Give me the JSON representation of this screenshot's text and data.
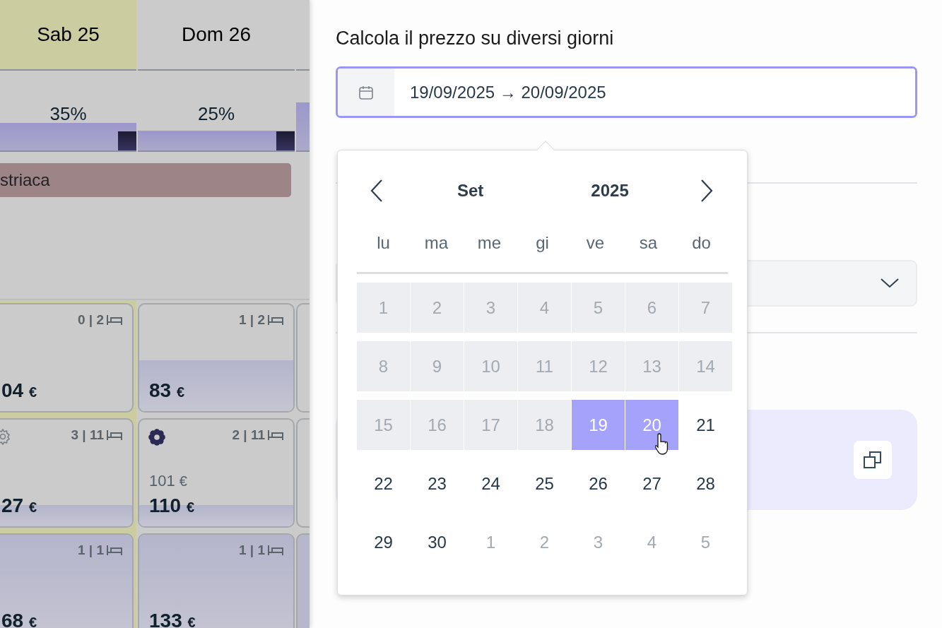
{
  "planner": {
    "columns": [
      {
        "day": "Sab 25",
        "weekend_highlight": true,
        "occupancy": "35%"
      },
      {
        "day": "Dom 26",
        "weekend_highlight": false,
        "occupancy": "25%"
      }
    ],
    "event": {
      "label": "striaca"
    },
    "cards": [
      [
        {
          "count": "0 | 2",
          "amount": "04",
          "currency": "€",
          "kind": "plain"
        },
        {
          "count": "3 | 11",
          "amount": "27",
          "currency": "€",
          "kind": "outlined"
        },
        {
          "count": "1 | 1",
          "amount": "68",
          "currency": "€",
          "kind": "plain"
        }
      ],
      [
        {
          "count": "1 | 2",
          "amount": "83",
          "currency": "€",
          "kind": "plain"
        },
        {
          "count": "2 | 11",
          "old_amount": "101",
          "old_currency": "€",
          "amount": "110",
          "currency": "€",
          "kind": "filled"
        },
        {
          "count": "1 | 1",
          "amount": "133",
          "currency": "€",
          "kind": "plain"
        }
      ]
    ]
  },
  "panel": {
    "title": "Calcola il prezzo su diversi giorni",
    "date_range": {
      "value": "19/09/2025 → 20/09/2025",
      "focused": true
    }
  },
  "calendar": {
    "month": "Set",
    "year": "2025",
    "weekdays": [
      "lu",
      "ma",
      "me",
      "gi",
      "ve",
      "sa",
      "do"
    ],
    "days": [
      {
        "label": "1",
        "kind": "unavailable",
        "selected": false
      },
      {
        "label": "2",
        "kind": "unavailable",
        "selected": false
      },
      {
        "label": "3",
        "kind": "unavailable",
        "selected": false
      },
      {
        "label": "4",
        "kind": "unavailable",
        "selected": false
      },
      {
        "label": "5",
        "kind": "unavailable",
        "selected": false
      },
      {
        "label": "6",
        "kind": "unavailable",
        "selected": false
      },
      {
        "label": "7",
        "kind": "unavailable",
        "selected": false
      },
      {
        "label": "8",
        "kind": "unavailable",
        "selected": false
      },
      {
        "label": "9",
        "kind": "unavailable",
        "selected": false
      },
      {
        "label": "10",
        "kind": "unavailable",
        "selected": false
      },
      {
        "label": "11",
        "kind": "unavailable",
        "selected": false
      },
      {
        "label": "12",
        "kind": "unavailable",
        "selected": false
      },
      {
        "label": "13",
        "kind": "unavailable",
        "selected": false
      },
      {
        "label": "14",
        "kind": "unavailable",
        "selected": false
      },
      {
        "label": "15",
        "kind": "unavailable",
        "selected": false
      },
      {
        "label": "16",
        "kind": "unavailable",
        "selected": false
      },
      {
        "label": "17",
        "kind": "unavailable",
        "selected": false
      },
      {
        "label": "18",
        "kind": "unavailable",
        "selected": false
      },
      {
        "label": "19",
        "kind": "available",
        "selected": true
      },
      {
        "label": "20",
        "kind": "available",
        "selected": true
      },
      {
        "label": "21",
        "kind": "available",
        "selected": false
      },
      {
        "label": "22",
        "kind": "available",
        "selected": false
      },
      {
        "label": "23",
        "kind": "available",
        "selected": false
      },
      {
        "label": "24",
        "kind": "available",
        "selected": false
      },
      {
        "label": "25",
        "kind": "available",
        "selected": false
      },
      {
        "label": "26",
        "kind": "available",
        "selected": false
      },
      {
        "label": "27",
        "kind": "available",
        "selected": false
      },
      {
        "label": "28",
        "kind": "available",
        "selected": false
      },
      {
        "label": "29",
        "kind": "available",
        "selected": false
      },
      {
        "label": "30",
        "kind": "available",
        "selected": false
      },
      {
        "label": "1",
        "kind": "overflow",
        "selected": false
      },
      {
        "label": "2",
        "kind": "overflow",
        "selected": false
      },
      {
        "label": "3",
        "kind": "overflow",
        "selected": false
      },
      {
        "label": "4",
        "kind": "overflow",
        "selected": false
      },
      {
        "label": "5",
        "kind": "overflow",
        "selected": false
      }
    ]
  }
}
